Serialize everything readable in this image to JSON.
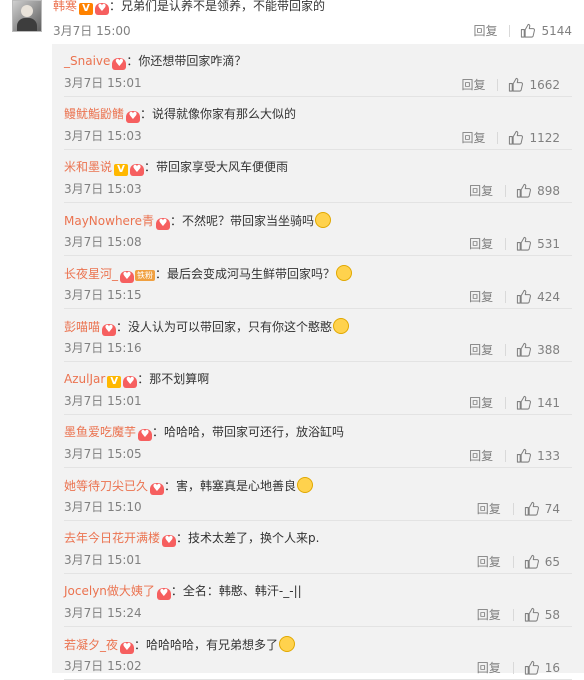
{
  "comment": {
    "author": "韩寒",
    "text": "：兄弟们是认养不是领养，不能带回家的",
    "time": "3月7日 15:00",
    "reply_label": "回复",
    "likes": "5144"
  },
  "replies": [
    {
      "author": "_Snaive",
      "text": "：你还想带回家咋滴？",
      "time": "3月7日 15:01",
      "reply_label": "回复",
      "likes": "1662"
    },
    {
      "author": "鳗鱿鮨鼢鳍",
      "text": "：说得就像你家有那么大似的",
      "time": "3月7日 15:03",
      "reply_label": "回复",
      "likes": "1122"
    },
    {
      "author": "米和墨说",
      "text": "：带回家享受大风车便便雨",
      "time": "3月7日 15:03",
      "reply_label": "回复",
      "likes": "898"
    },
    {
      "author": "MayNowhere青",
      "text": "：不然呢？带回家当坐骑吗",
      "time": "3月7日 15:08",
      "reply_label": "回复",
      "likes": "531"
    },
    {
      "author": "长夜星河_",
      "text": "：最后会变成河马生鲜带回家吗？",
      "time": "3月7日 15:15",
      "reply_label": "回复",
      "likes": "424",
      "fans_badge": "铁粉"
    },
    {
      "author": "彭喵喵",
      "text": "：没人认为可以带回家，只有你这个憨憨",
      "time": "3月7日 15:16",
      "reply_label": "回复",
      "likes": "388"
    },
    {
      "author": "AzulJar",
      "text": "：那不划算啊",
      "time": "3月7日 15:01",
      "reply_label": "回复",
      "likes": "141"
    },
    {
      "author": "墨鱼爱吃魔芋",
      "text": "：哈哈哈，带回家可还行，放浴缸吗",
      "time": "3月7日 15:05",
      "reply_label": "回复",
      "likes": "133"
    },
    {
      "author": "她等待刀尖已久",
      "text": "：害，韩塞真是心地善良",
      "time": "3月7日 15:10",
      "reply_label": "回复",
      "likes": "74"
    },
    {
      "author": "去年今日花开满楼",
      "text": "：技术太差了，换个人来p.",
      "time": "3月7日 15:01",
      "reply_label": "回复",
      "likes": "65"
    },
    {
      "author": "Jocelyn做大姨了",
      "text": "：全名：韩憨、韩汗-_-||",
      "time": "3月7日 15:24",
      "reply_label": "回复",
      "likes": "58"
    },
    {
      "author": "若凝夕_夜",
      "text": "：哈哈哈哈，有兄弟想多了",
      "time": "3月7日 15:02",
      "reply_label": "回复",
      "likes": "16"
    }
  ],
  "colors": {
    "name": "#eb7350",
    "meta": "#808080",
    "panel": "#f2f2f2"
  },
  "icons": {
    "like": "thumb-up-icon",
    "verified": "v-badge-icon",
    "member": "heart-badge-icon",
    "emoji": "emoji-face-icon"
  }
}
